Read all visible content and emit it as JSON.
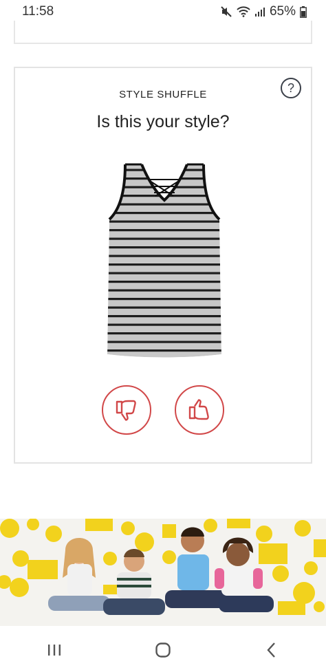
{
  "status_bar": {
    "time": "11:58",
    "battery_percent": "65%",
    "icons": [
      "mute-icon",
      "wifi-icon",
      "signal-icon",
      "battery-icon"
    ]
  },
  "card": {
    "kicker": "STYLE SHUFFLE",
    "title": "Is this your style?",
    "help_label": "?",
    "product_image": "striped-tank-top-image",
    "dislike_icon": "thumbs-down-icon",
    "like_icon": "thumbs-up-icon"
  },
  "banner": {
    "image": "kids-promo-banner"
  },
  "nav": {
    "recents_icon": "recents-icon",
    "home_icon": "home-icon",
    "back_icon": "back-icon"
  },
  "colors": {
    "accent_red": "#d14748",
    "help_icon": "#3a3f48",
    "banner_yellow": "#f2d21d"
  }
}
